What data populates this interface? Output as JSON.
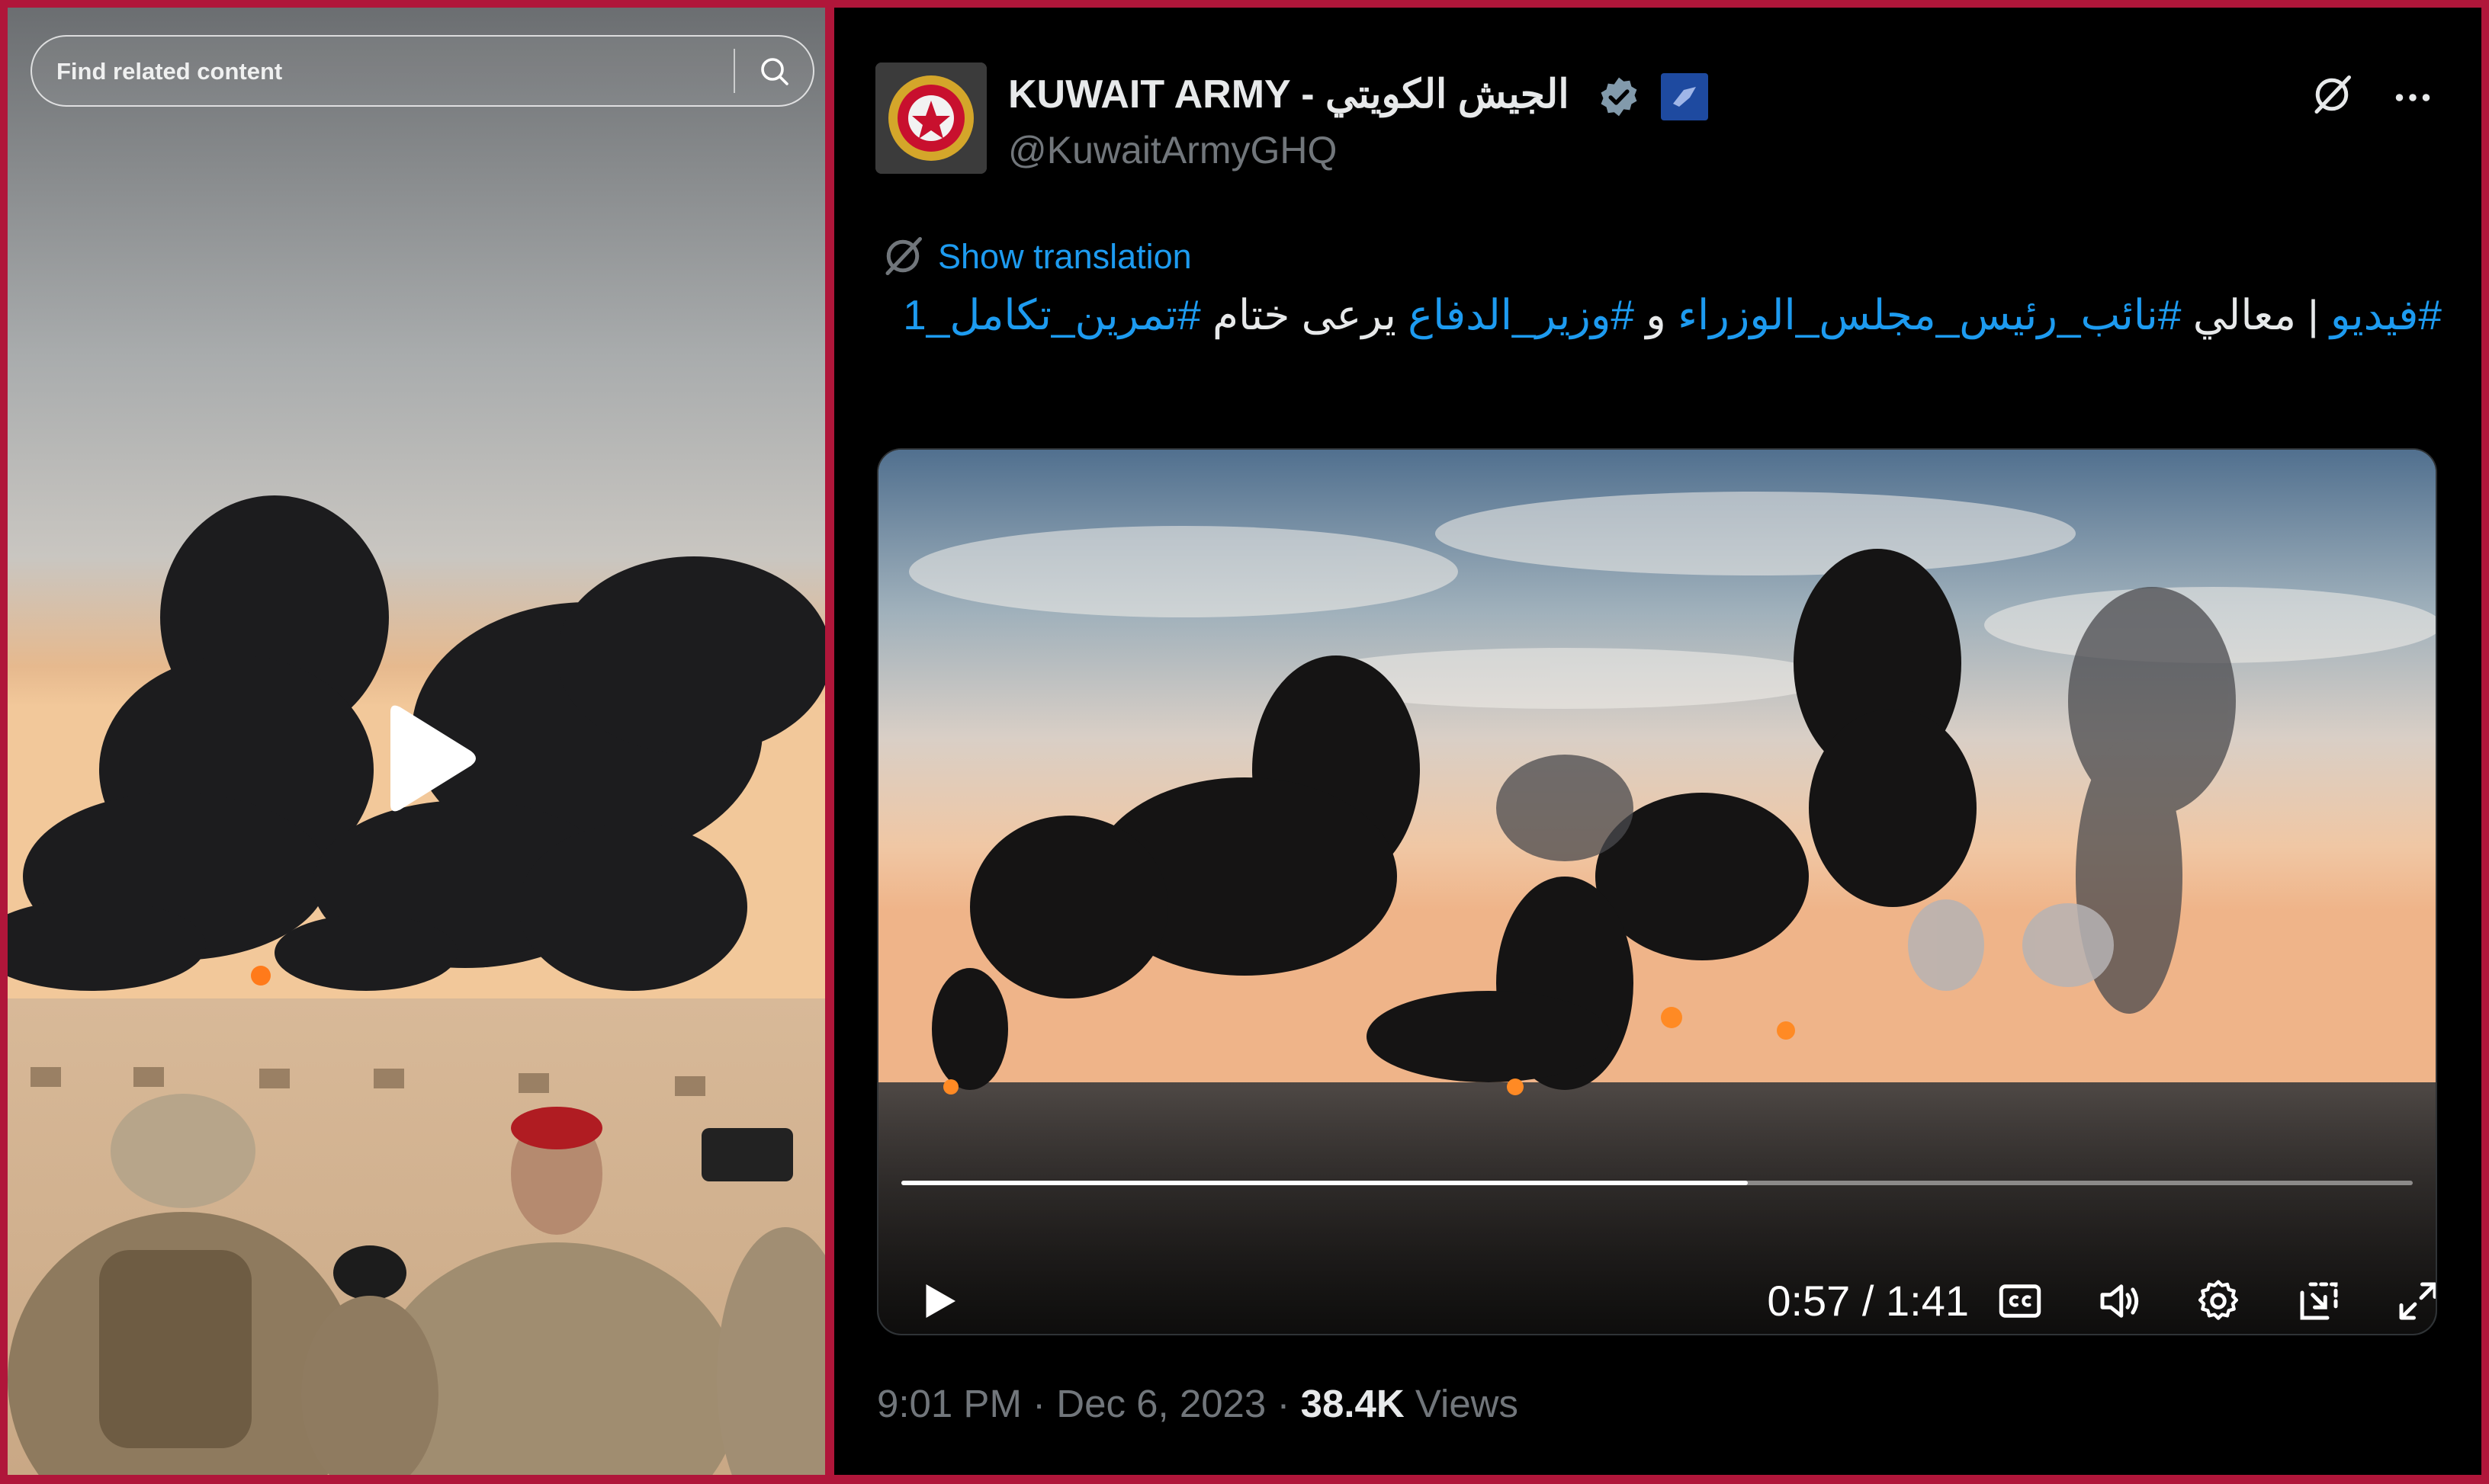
{
  "related": {
    "search_placeholder": "Find related content",
    "icons": {
      "search": "search-icon",
      "play": "play-icon"
    }
  },
  "tweet": {
    "display_name": "KUWAIT ARMY - الجيش الكويتي",
    "handle": "@KuwaitArmyGHQ",
    "show_translation": "Show translation",
    "text": {
      "tag_video": "#فيديو",
      "sep": " | معالي ",
      "tag_deputy_pm": "#نائب_رئيس_مجلس_الوزراء",
      "and": " و ",
      "tag_defense_minister": "#وزير_الدفاع",
      "patronizes": " يرعى ختام ",
      "tag_exercise": "#تمرين_تكامل_1"
    },
    "time": "9:01 PM",
    "dot1": " · ",
    "date": "Dec 6, 2023",
    "dot2": " · ",
    "views_count": "38.4K",
    "views_label": " Views",
    "icons": [
      "verified-icon",
      "affiliation-badge",
      "grok-icon",
      "more-icon",
      "translate-icon"
    ]
  },
  "video": {
    "current_time": "0:57",
    "separator": " / ",
    "duration": "1:41",
    "progress_fraction": 0.56,
    "controls": [
      "play-icon",
      "cc-icon",
      "volume-icon",
      "settings-icon",
      "pip-icon",
      "fullscreen-icon"
    ]
  },
  "colors": {
    "page_border": "#b0163a",
    "accent": "#1d9bf0",
    "text_primary": "#e7e9ea",
    "text_secondary": "#71767b",
    "background": "#000000"
  }
}
